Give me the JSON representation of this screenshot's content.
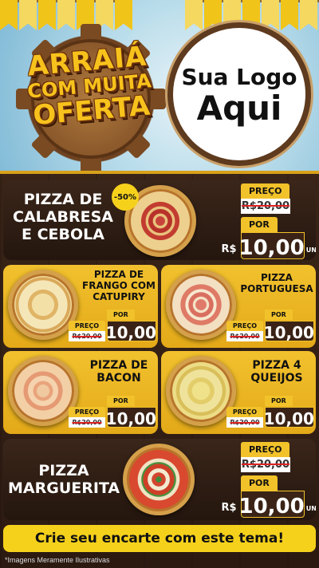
{
  "header": {
    "title_line1": "ARRAIÁ",
    "title_line2": "COM MUITA",
    "title_line3": "OFERTA",
    "logo_line1": "Sua Logo",
    "logo_line2": "Aqui"
  },
  "labels": {
    "preco": "PREÇO",
    "por": "POR",
    "currency": "R$",
    "unit": "UNID"
  },
  "featured": [
    {
      "name_l1": "PIZZA DE",
      "name_l2": "CALABRESA",
      "name_l3": "E CEBOLA",
      "badge": "-50%",
      "old_price": "R$20,00",
      "price": "10,00",
      "image": "pizza-calabresa"
    },
    {
      "name_l1": "PIZZA",
      "name_l2": "MARGUERITA",
      "old_price": "R$20,00",
      "price": "10,00",
      "image": "pizza-marguerita"
    }
  ],
  "grid": [
    {
      "name_l1": "PIZZA DE",
      "name_l2": "FRANGO COM",
      "name_l3": "CATUPIRY",
      "old_price": "R$20,00",
      "price": "10,00",
      "image": "pizza-frango"
    },
    {
      "name_l1": "PIZZA",
      "name_l2": "PORTUGUESA",
      "old_price": "R$20,00",
      "price": "10,00",
      "image": "pizza-portuguesa"
    },
    {
      "name_l1": "PIZZA DE",
      "name_l2": "BACON",
      "old_price": "R$20,00",
      "price": "10,00",
      "image": "pizza-bacon"
    },
    {
      "name_l1": "PIZZA 4",
      "name_l2": "QUEIJOS",
      "old_price": "R$20,00",
      "price": "10,00",
      "image": "pizza-queijos"
    }
  ],
  "cta": "Crie seu encarte com este tema!",
  "footnote": "*Imagens Meramente Ilustrativas",
  "colors": {
    "accent": "#f6d11c",
    "wood": "#2c1a11",
    "card_yellow": "#e9b21e"
  }
}
